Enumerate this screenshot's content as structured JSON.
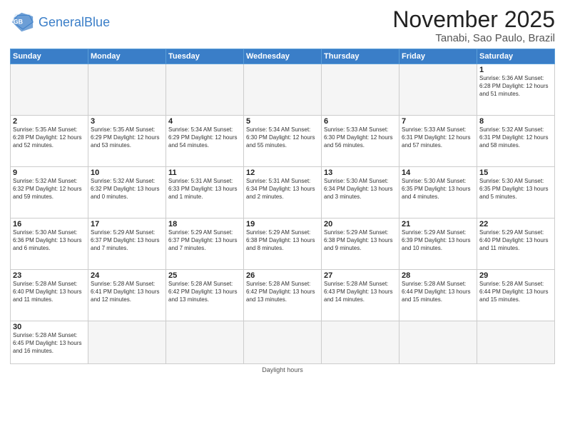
{
  "logo": {
    "general": "General",
    "blue": "Blue"
  },
  "header": {
    "month": "November 2025",
    "location": "Tanabi, Sao Paulo, Brazil"
  },
  "weekdays": [
    "Sunday",
    "Monday",
    "Tuesday",
    "Wednesday",
    "Thursday",
    "Friday",
    "Saturday"
  ],
  "weeks": [
    [
      {
        "day": "",
        "info": ""
      },
      {
        "day": "",
        "info": ""
      },
      {
        "day": "",
        "info": ""
      },
      {
        "day": "",
        "info": ""
      },
      {
        "day": "",
        "info": ""
      },
      {
        "day": "",
        "info": ""
      },
      {
        "day": "1",
        "info": "Sunrise: 5:36 AM\nSunset: 6:28 PM\nDaylight: 12 hours\nand 51 minutes."
      }
    ],
    [
      {
        "day": "2",
        "info": "Sunrise: 5:35 AM\nSunset: 6:28 PM\nDaylight: 12 hours\nand 52 minutes."
      },
      {
        "day": "3",
        "info": "Sunrise: 5:35 AM\nSunset: 6:29 PM\nDaylight: 12 hours\nand 53 minutes."
      },
      {
        "day": "4",
        "info": "Sunrise: 5:34 AM\nSunset: 6:29 PM\nDaylight: 12 hours\nand 54 minutes."
      },
      {
        "day": "5",
        "info": "Sunrise: 5:34 AM\nSunset: 6:30 PM\nDaylight: 12 hours\nand 55 minutes."
      },
      {
        "day": "6",
        "info": "Sunrise: 5:33 AM\nSunset: 6:30 PM\nDaylight: 12 hours\nand 56 minutes."
      },
      {
        "day": "7",
        "info": "Sunrise: 5:33 AM\nSunset: 6:31 PM\nDaylight: 12 hours\nand 57 minutes."
      },
      {
        "day": "8",
        "info": "Sunrise: 5:32 AM\nSunset: 6:31 PM\nDaylight: 12 hours\nand 58 minutes."
      }
    ],
    [
      {
        "day": "9",
        "info": "Sunrise: 5:32 AM\nSunset: 6:32 PM\nDaylight: 12 hours\nand 59 minutes."
      },
      {
        "day": "10",
        "info": "Sunrise: 5:32 AM\nSunset: 6:32 PM\nDaylight: 13 hours\nand 0 minutes."
      },
      {
        "day": "11",
        "info": "Sunrise: 5:31 AM\nSunset: 6:33 PM\nDaylight: 13 hours\nand 1 minute."
      },
      {
        "day": "12",
        "info": "Sunrise: 5:31 AM\nSunset: 6:34 PM\nDaylight: 13 hours\nand 2 minutes."
      },
      {
        "day": "13",
        "info": "Sunrise: 5:30 AM\nSunset: 6:34 PM\nDaylight: 13 hours\nand 3 minutes."
      },
      {
        "day": "14",
        "info": "Sunrise: 5:30 AM\nSunset: 6:35 PM\nDaylight: 13 hours\nand 4 minutes."
      },
      {
        "day": "15",
        "info": "Sunrise: 5:30 AM\nSunset: 6:35 PM\nDaylight: 13 hours\nand 5 minutes."
      }
    ],
    [
      {
        "day": "16",
        "info": "Sunrise: 5:30 AM\nSunset: 6:36 PM\nDaylight: 13 hours\nand 6 minutes."
      },
      {
        "day": "17",
        "info": "Sunrise: 5:29 AM\nSunset: 6:37 PM\nDaylight: 13 hours\nand 7 minutes."
      },
      {
        "day": "18",
        "info": "Sunrise: 5:29 AM\nSunset: 6:37 PM\nDaylight: 13 hours\nand 7 minutes."
      },
      {
        "day": "19",
        "info": "Sunrise: 5:29 AM\nSunset: 6:38 PM\nDaylight: 13 hours\nand 8 minutes."
      },
      {
        "day": "20",
        "info": "Sunrise: 5:29 AM\nSunset: 6:38 PM\nDaylight: 13 hours\nand 9 minutes."
      },
      {
        "day": "21",
        "info": "Sunrise: 5:29 AM\nSunset: 6:39 PM\nDaylight: 13 hours\nand 10 minutes."
      },
      {
        "day": "22",
        "info": "Sunrise: 5:29 AM\nSunset: 6:40 PM\nDaylight: 13 hours\nand 11 minutes."
      }
    ],
    [
      {
        "day": "23",
        "info": "Sunrise: 5:28 AM\nSunset: 6:40 PM\nDaylight: 13 hours\nand 11 minutes."
      },
      {
        "day": "24",
        "info": "Sunrise: 5:28 AM\nSunset: 6:41 PM\nDaylight: 13 hours\nand 12 minutes."
      },
      {
        "day": "25",
        "info": "Sunrise: 5:28 AM\nSunset: 6:42 PM\nDaylight: 13 hours\nand 13 minutes."
      },
      {
        "day": "26",
        "info": "Sunrise: 5:28 AM\nSunset: 6:42 PM\nDaylight: 13 hours\nand 13 minutes."
      },
      {
        "day": "27",
        "info": "Sunrise: 5:28 AM\nSunset: 6:43 PM\nDaylight: 13 hours\nand 14 minutes."
      },
      {
        "day": "28",
        "info": "Sunrise: 5:28 AM\nSunset: 6:44 PM\nDaylight: 13 hours\nand 15 minutes."
      },
      {
        "day": "29",
        "info": "Sunrise: 5:28 AM\nSunset: 6:44 PM\nDaylight: 13 hours\nand 15 minutes."
      }
    ],
    [
      {
        "day": "30",
        "info": "Sunrise: 5:28 AM\nSunset: 6:45 PM\nDaylight: 13 hours\nand 16 minutes."
      },
      {
        "day": "",
        "info": ""
      },
      {
        "day": "",
        "info": ""
      },
      {
        "day": "",
        "info": ""
      },
      {
        "day": "",
        "info": ""
      },
      {
        "day": "",
        "info": ""
      },
      {
        "day": "",
        "info": ""
      }
    ]
  ],
  "footer": {
    "daylight_hours": "Daylight hours"
  }
}
